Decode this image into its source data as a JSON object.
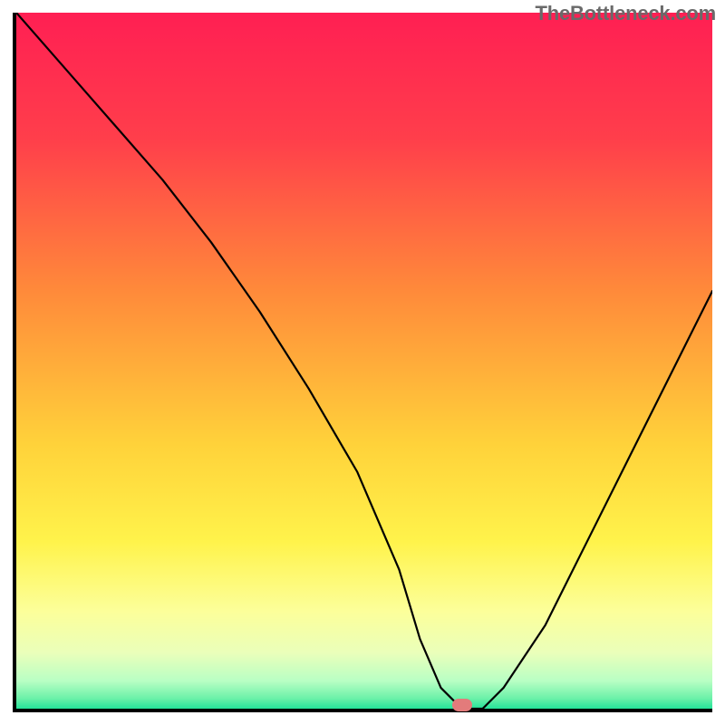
{
  "watermark": "TheBottleneck.com",
  "chart_data": {
    "type": "line",
    "title": "",
    "xlabel": "",
    "ylabel": "",
    "xlim": [
      0,
      100
    ],
    "ylim": [
      0,
      100
    ],
    "x": [
      0,
      7,
      14,
      21,
      28,
      35,
      42,
      49,
      55,
      58,
      61,
      64,
      67,
      70,
      76,
      82,
      88,
      94,
      100
    ],
    "values": [
      100,
      92,
      84,
      76,
      67,
      57,
      46,
      34,
      20,
      10,
      3,
      0,
      0,
      3,
      12,
      24,
      36,
      48,
      60
    ],
    "marker": {
      "x": 64,
      "y": 0.5,
      "shape": "pill",
      "color": "#e37b7b"
    },
    "background_gradient": {
      "stops": [
        {
          "offset": 0.0,
          "color": "#ff1f53"
        },
        {
          "offset": 0.18,
          "color": "#ff3e4b"
        },
        {
          "offset": 0.4,
          "color": "#ff8a3a"
        },
        {
          "offset": 0.62,
          "color": "#ffd23a"
        },
        {
          "offset": 0.76,
          "color": "#fff34b"
        },
        {
          "offset": 0.86,
          "color": "#fcff9a"
        },
        {
          "offset": 0.92,
          "color": "#eaffba"
        },
        {
          "offset": 0.96,
          "color": "#b9ffc4"
        },
        {
          "offset": 0.985,
          "color": "#6cf1a9"
        },
        {
          "offset": 1.0,
          "color": "#24e39a"
        }
      ]
    },
    "line_color": "#000000",
    "line_width": 2.2
  }
}
